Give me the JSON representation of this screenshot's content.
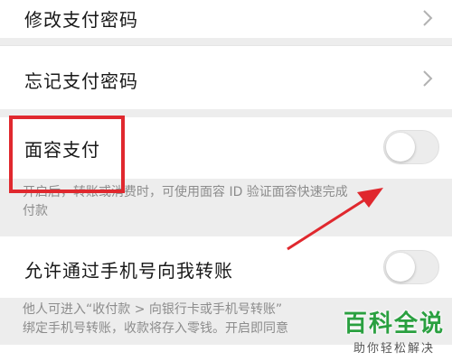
{
  "settings": {
    "change_password": {
      "label": "修改支付密码"
    },
    "forgot_password": {
      "label": "忘记支付密码"
    },
    "face_pay": {
      "label": "面容支付",
      "enabled": false,
      "description_line1": "开启后，转账或消费时，可使用面容 ID 验证面容快速完成",
      "description_line2": "付款"
    },
    "allow_phone_transfer": {
      "label": "允许通过手机号向我转账",
      "enabled": false,
      "description_line1": "他人可进入“收付款 > 向银行卡或手机号转账”",
      "description_line2": "绑定手机号转账，收款将存入零钱。开启即同意"
    }
  },
  "annotation": {
    "color": "#e0282e"
  },
  "watermark": {
    "title": "百科全说",
    "subtitle": "助你轻松解决",
    "color": "#2aa040"
  }
}
